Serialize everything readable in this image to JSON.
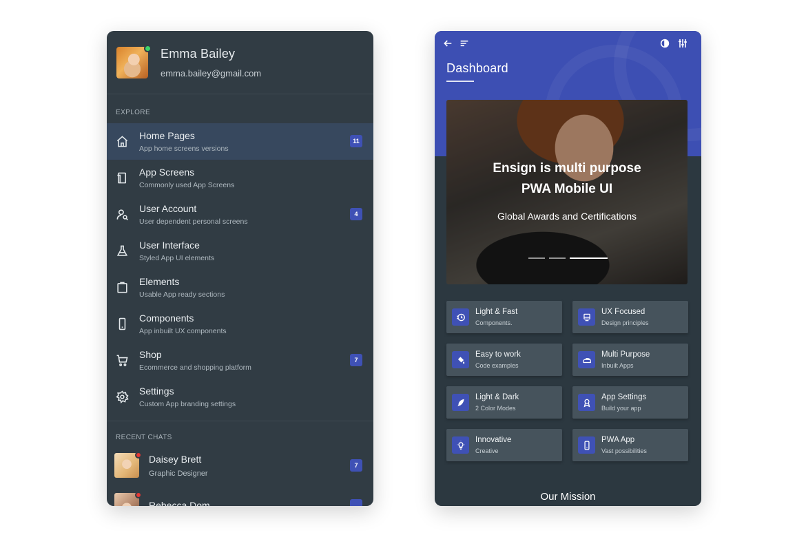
{
  "sidebar": {
    "profile": {
      "name": "Emma Bailey",
      "email": "emma.bailey@gmail.com"
    },
    "explore_title": "EXPLORE",
    "items": [
      {
        "title": "Home Pages",
        "subtitle": "App home screens versions",
        "badge": "11",
        "icon": "home-icon"
      },
      {
        "title": "App Screens",
        "subtitle": "Commonly used App Screens",
        "badge": null,
        "icon": "screens-icon"
      },
      {
        "title": "User Account",
        "subtitle": "User dependent personal screens",
        "badge": "4",
        "icon": "user-search-icon"
      },
      {
        "title": "User Interface",
        "subtitle": "Styled App UI elements",
        "badge": null,
        "icon": "flask-icon"
      },
      {
        "title": "Elements",
        "subtitle": "Usable App ready sections",
        "badge": null,
        "icon": "clipboard-icon"
      },
      {
        "title": "Components",
        "subtitle": "App inbuilt UX components",
        "badge": null,
        "icon": "phone-icon"
      },
      {
        "title": "Shop",
        "subtitle": "Ecommerce and shopping platform",
        "badge": "7",
        "icon": "cart-icon"
      },
      {
        "title": "Settings",
        "subtitle": "Custom App branding settings",
        "badge": null,
        "icon": "gear-icon"
      }
    ],
    "chats_title": "RECENT CHATS",
    "chats": [
      {
        "name": "Daisey Brett",
        "role": "Graphic Designer",
        "badge": "7"
      },
      {
        "name": "Rebecca Dom",
        "role": "",
        "badge": ""
      }
    ]
  },
  "dashboard": {
    "title": "Dashboard",
    "banner": {
      "line1": "Ensign is multi purpose",
      "line2": "PWA Mobile UI",
      "line3": "Global Awards and Certifications"
    },
    "features": [
      {
        "title": "Light & Fast",
        "subtitle": "Components.",
        "icon": "speed-clock-icon"
      },
      {
        "title": "UX Focused",
        "subtitle": "Design principles",
        "icon": "monitor-icon"
      },
      {
        "title": "Easy to work",
        "subtitle": "Code examples",
        "icon": "paint-bucket-icon"
      },
      {
        "title": "Multi Purpose",
        "subtitle": "Inbuilt Apps",
        "icon": "iron-icon"
      },
      {
        "title": "Light & Dark",
        "subtitle": "2 Color Modes",
        "icon": "feather-icon"
      },
      {
        "title": "App Settings",
        "subtitle": "Build your app",
        "icon": "award-icon"
      },
      {
        "title": "Innovative",
        "subtitle": "Creative",
        "icon": "lightbulb-icon"
      },
      {
        "title": "PWA App",
        "subtitle": "Vast possibilities",
        "icon": "mobile-icon"
      }
    ],
    "mission_title": "Our Mission"
  },
  "colors": {
    "sidebar_bg": "#313c44",
    "active_item_bg": "#37485e",
    "accent": "#3f51b5",
    "header_bg": "#3d4fb3",
    "card_bg": "#46535c",
    "online": "#3ed36a",
    "alert": "#e53935"
  }
}
